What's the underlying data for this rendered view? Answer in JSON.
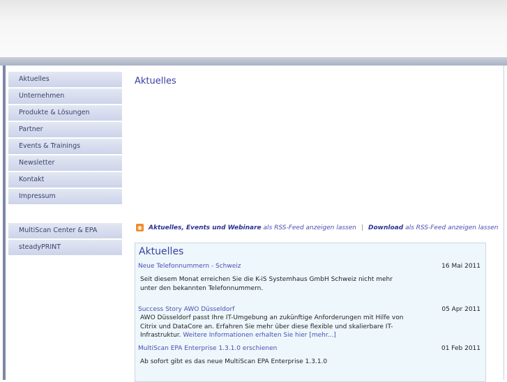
{
  "nav": {
    "main": [
      "Aktuelles",
      "Unternehmen",
      "Produkte & Lösungen",
      "Partner",
      "Events & Trainings",
      "Newsletter",
      "Kontakt",
      "Impressum"
    ],
    "secondary": [
      "MultiScan Center & EPA",
      "steadyPRINT"
    ]
  },
  "page_title": "Aktuelles",
  "rss": {
    "link1": "Aktuelles, Events und Webinare",
    "text1": "als RSS-Feed anzeigen lassen",
    "sep": "|",
    "link2": "Download",
    "text2": "als RSS-Feed anzeigen lassen"
  },
  "news": {
    "heading": "Aktuelles",
    "items": [
      {
        "title": "Neue Telefonnummern - Schweiz",
        "date": "16 Mai 2011",
        "body": "Seit diesem Monat erreichen Sie die K-iS Systemhaus GmbH Schweiz nicht mehr unter den bekannten Telefonnummern.",
        "more": ""
      },
      {
        "title": "Success Story AWO Düsseldorf",
        "date": "05 Apr 2011",
        "body": "AWO Düsseldorf passt Ihre IT-Umgebung an zukünftige Anforderungen mit Hilfe von Citrix und DataCore an. Erfahren Sie mehr über diese flexible und skalierbare IT-Infrastruktur. ",
        "more": "Weitere Informationen erhalten Sie hier [mehr...]"
      },
      {
        "title": "MultiScan EPA Enterprise 1.3.1.0 erschienen",
        "date": "01 Feb 2011",
        "body": "Ab sofort gibt es das neue MultiScan EPA Enterprise 1.3.1.0",
        "more": ""
      }
    ]
  }
}
